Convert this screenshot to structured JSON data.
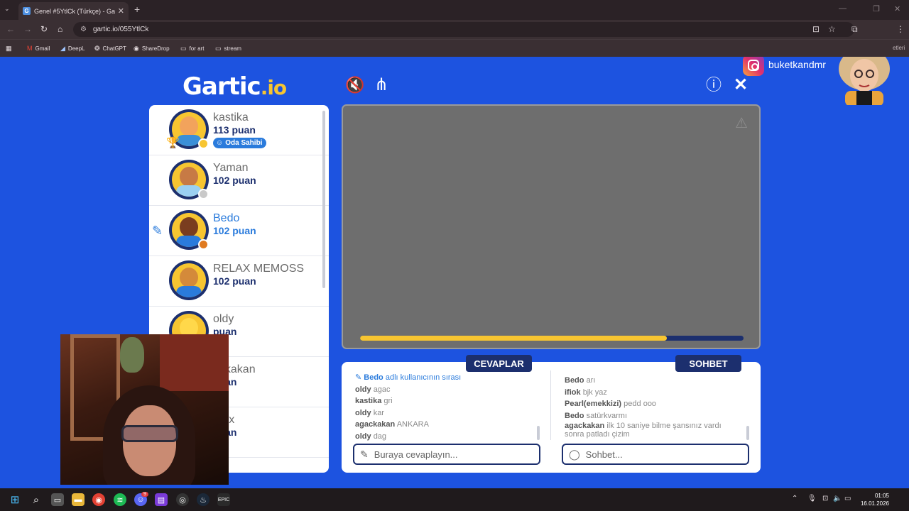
{
  "browser": {
    "tab_title": "Genel #5YtlCk (Türkçe) - Gartic.io",
    "tab_favicon": "G",
    "url": "gartic.io/055YtlCk",
    "bookmarks": [
      {
        "label": "Gmail",
        "icon": "gmail-icon"
      },
      {
        "label": "DeepL",
        "icon": "deepl-icon"
      },
      {
        "label": "ChatGPT",
        "icon": "chatgpt-icon"
      },
      {
        "label": "ShareDrop",
        "icon": "sharedrop-icon"
      },
      {
        "label": "for art",
        "icon": "folder-icon"
      },
      {
        "label": "stream",
        "icon": "folder-icon"
      }
    ],
    "bookmarks_overflow": "etleri"
  },
  "game": {
    "logo_main": "Gartic",
    "logo_suffix": ".io",
    "instagram_handle": "buketkandmr",
    "players": [
      {
        "name": "kastika",
        "points": "113 puan",
        "badge": "Oda Sahibi",
        "rank": "1",
        "avatar_color": "#3a8fd8",
        "status": "#f7c531"
      },
      {
        "name": "Yaman",
        "points": "102 puan",
        "avatar_color": "#b5652e",
        "status": "#c9c9c9"
      },
      {
        "name": "Bedo",
        "points": "102 puan",
        "avatar_color": "#7a3d1f",
        "status": "#e07a1f",
        "drawing": true
      },
      {
        "name": "RELAX MEMOSS",
        "points": "102 puan",
        "avatar_color": "#d48a3a",
        "status": ""
      },
      {
        "name": "oldy",
        "points": "puan",
        "avatar_color": "#f7c531",
        "status": ""
      },
      {
        "name": "ackakan",
        "points": "puan",
        "avatar_color": "",
        "status": ""
      },
      {
        "name": "rkex",
        "points": "puan",
        "avatar_color": "",
        "status": ""
      }
    ],
    "timer_progress": 0.8,
    "answers_tab": "CEVAPLAR",
    "chat_tab": "SOHBET",
    "answers": [
      {
        "who": "Bedo",
        "text": "adlı kullanıcının sırası",
        "highlight": true
      },
      {
        "who": "oldy",
        "text": "agac"
      },
      {
        "who": "kastika",
        "text": "gri"
      },
      {
        "who": "oldy",
        "text": "kar"
      },
      {
        "who": "agackakan",
        "text": "ANKARA"
      },
      {
        "who": "oldy",
        "text": "dag"
      }
    ],
    "chat": [
      {
        "who": "Bedo",
        "text": "arı"
      },
      {
        "who": "ifiok",
        "text": "bjk yaz"
      },
      {
        "who": "Pearl(emekkizi)",
        "text": "pedd ooo"
      },
      {
        "who": "Bedo",
        "text": "satürkvarmı"
      },
      {
        "who": "agackakan",
        "text": "ilk 10 saniye bilme şansınız vardı sonra patladı çizim"
      }
    ],
    "answer_placeholder": "Buraya cevaplayın...",
    "chat_placeholder": "Sohbet..."
  },
  "taskbar": {
    "time": "01:05",
    "date": "16.01.2026",
    "discord_badge": "9"
  }
}
